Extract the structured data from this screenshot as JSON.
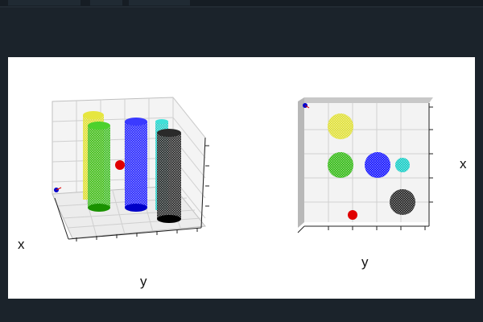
{
  "window": {
    "title": ""
  },
  "left_plot": {
    "xlabel": "x",
    "ylabel": "y"
  },
  "right_plot": {
    "xlabel": "x",
    "ylabel": "y"
  },
  "colors": {
    "background": "#1b232b",
    "panel": "#ffffff",
    "yellow": "#d8d800",
    "green": "#21b300",
    "blue": "#0000ff",
    "cyan": "#00c8c0",
    "black": "#111111",
    "red": "#e00000"
  },
  "objects": [
    {
      "name": "yellow-cylinder",
      "color": "yellow"
    },
    {
      "name": "green-cylinder",
      "color": "green"
    },
    {
      "name": "blue-cylinder",
      "color": "blue"
    },
    {
      "name": "cyan-cylinder",
      "color": "cyan"
    },
    {
      "name": "black-cylinder",
      "color": "black"
    },
    {
      "name": "red-sphere",
      "color": "red"
    }
  ]
}
